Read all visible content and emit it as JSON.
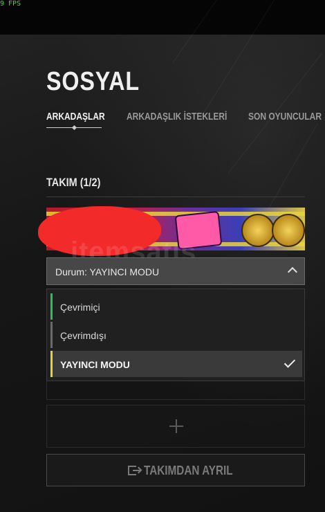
{
  "overlay": {
    "fps": "9 FPS"
  },
  "page": {
    "title": "SOSYAL"
  },
  "tabs": [
    {
      "label": "ARKADAŞLAR",
      "active": true
    },
    {
      "label": "ARKADAŞLIK İSTEKLERİ",
      "active": false
    },
    {
      "label": "SON OYUNCULAR",
      "active": false
    }
  ],
  "team": {
    "heading": "TAKIM (1/2)",
    "watermark": "itemsatış"
  },
  "status": {
    "current": "Durum: YAYINCI MODU",
    "options": [
      {
        "label": "Çevrimiçi",
        "color": "#22c55e",
        "selected": false
      },
      {
        "label": "Çevrimdışı",
        "color": "#6b6b6b",
        "selected": false
      },
      {
        "label": "YAYINCI MODU",
        "color": "#e6d43a",
        "selected": true
      }
    ]
  },
  "actions": {
    "leave_team": "TAKIMDAN AYRIL"
  },
  "colors": {
    "accent_online": "#22c55e",
    "accent_streamer": "#e6d43a",
    "redaction": "#f22a2a"
  }
}
